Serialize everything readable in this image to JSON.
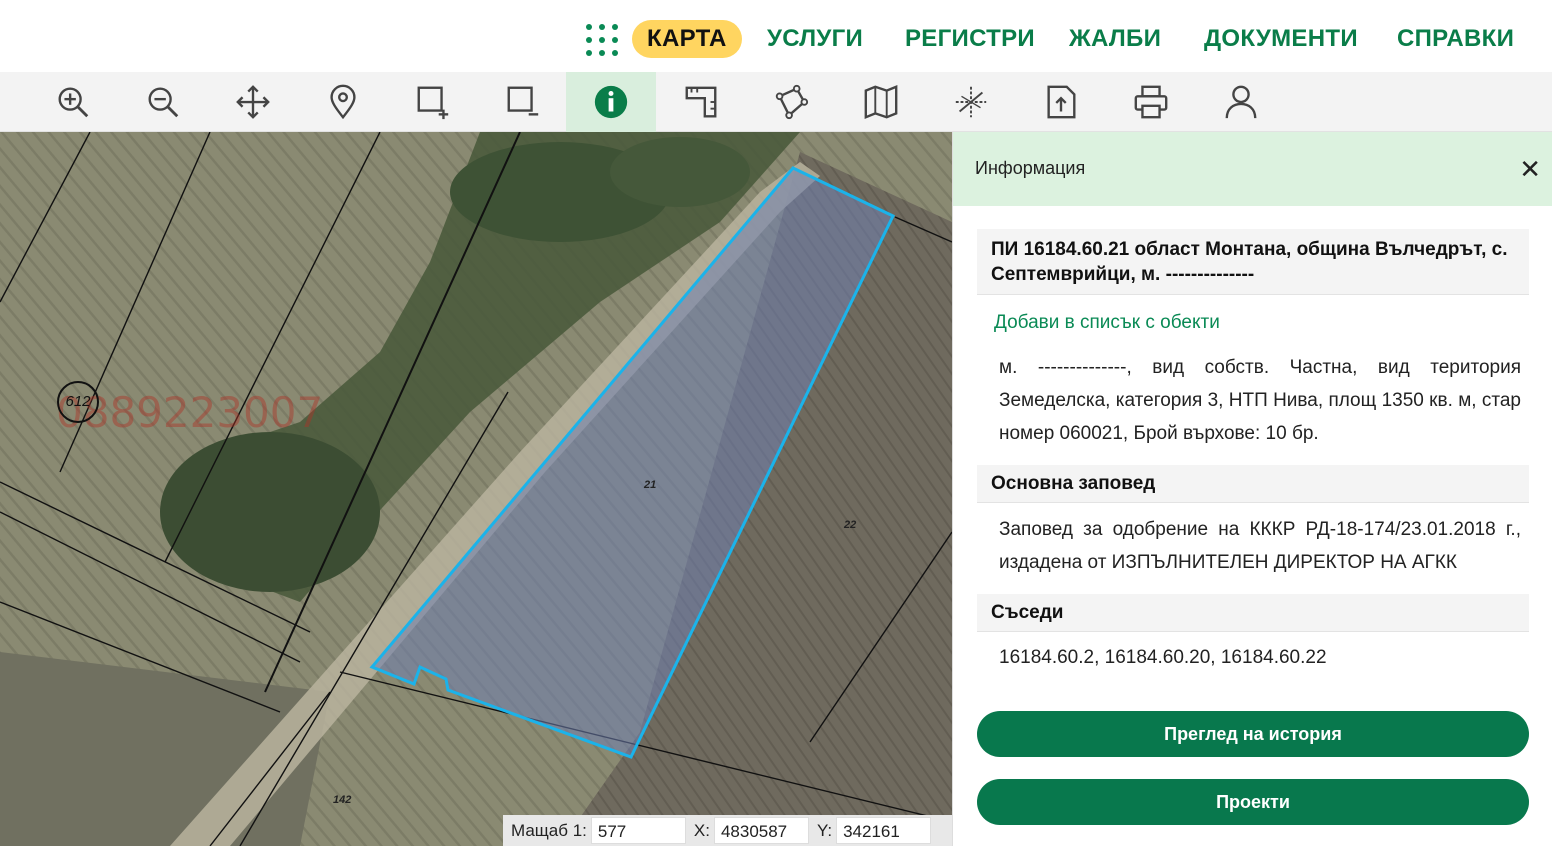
{
  "nav": {
    "items": [
      {
        "label": "КАРТА",
        "active": true
      },
      {
        "label": "УСЛУГИ"
      },
      {
        "label": "РЕГИСТРИ"
      },
      {
        "label": "ЖАЛБИ"
      },
      {
        "label": "ДОКУМЕНТИ"
      },
      {
        "label": "СПРАВКИ"
      }
    ],
    "accent_color": "#0a7d49",
    "active_bg": "#ffd560"
  },
  "toolbar": {
    "tools": [
      {
        "icon": "zoom-in-icon"
      },
      {
        "icon": "zoom-out-icon"
      },
      {
        "icon": "pan-move-icon"
      },
      {
        "icon": "location-pin-icon"
      },
      {
        "icon": "select-add-icon"
      },
      {
        "icon": "select-remove-icon"
      },
      {
        "icon": "info-icon",
        "active": true
      },
      {
        "icon": "measure-ruler-icon"
      },
      {
        "icon": "polygon-draw-icon"
      },
      {
        "icon": "map-layers-icon"
      },
      {
        "icon": "coordinates-grid-icon"
      },
      {
        "icon": "export-document-icon"
      },
      {
        "icon": "print-icon"
      },
      {
        "icon": "user-icon"
      }
    ]
  },
  "map": {
    "watermark": "0889223007",
    "circle_number": "612",
    "parcel_labels": [
      "21",
      "22",
      "142"
    ]
  },
  "status": {
    "scale_label": "Мащаб 1:",
    "scale_value": "577",
    "x_label": "X:",
    "x_value": "4830587",
    "y_label": "Y:",
    "y_value": "342161"
  },
  "panel": {
    "title": "Информация",
    "parcel_title": "ПИ 16184.60.21 област Монтана, община Вълчедрът, с. Септемврийци, м. --------------",
    "add_link": "Добави в списък с обекти",
    "description": "м. --------------, вид собств. Частна, вид територия Земеделска, категория 3, НТП Нива, площ 1350 кв. м, стар номер 060021, Брой върхове: 10 бр.",
    "order_heading": "Основна заповед",
    "order_text": "Заповед за одобрение на КККР РД-18-174/23.01.2018 г., издадена от ИЗПЪЛНИТЕЛЕН ДИРЕКТОР НА АГКК",
    "neighbors_heading": "Съседи",
    "neighbors_text": "16184.60.2, 16184.60.20, 16184.60.22",
    "history_button": "Преглед на история",
    "projects_button": "Проекти",
    "button_color": "#08784d"
  }
}
